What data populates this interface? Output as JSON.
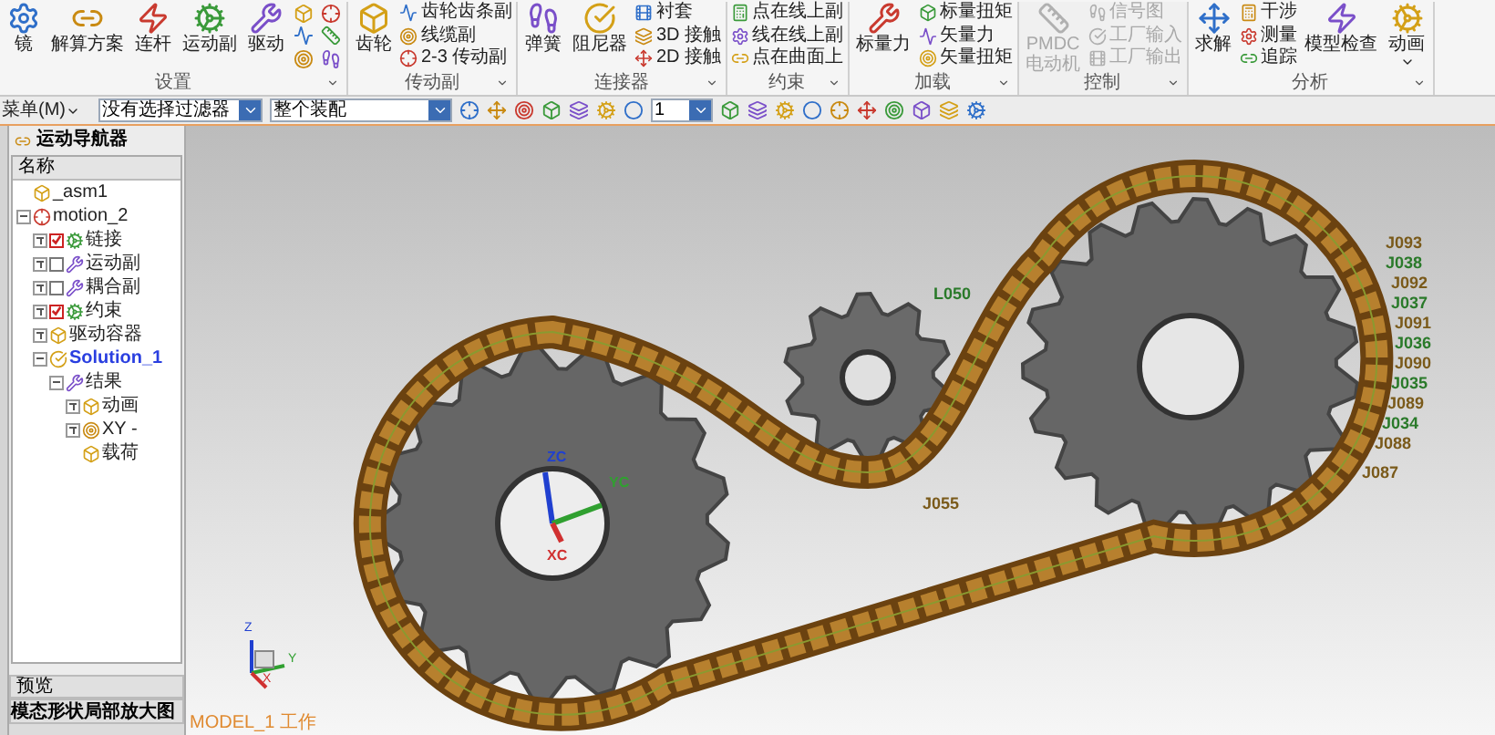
{
  "ribbon": {
    "groups": [
      {
        "label": "设置",
        "disabled": false,
        "buttons": [
          {
            "kind": "large",
            "label": "镜"
          },
          {
            "kind": "large",
            "label": "解算方案"
          },
          {
            "kind": "large",
            "label": "连杆"
          },
          {
            "kind": "large",
            "label": "运动副"
          },
          {
            "kind": "large",
            "label": "驱动"
          },
          {
            "kind": "icon"
          },
          {
            "kind": "icon"
          },
          {
            "kind": "icon"
          },
          {
            "kind": "icon"
          },
          {
            "kind": "icon"
          },
          {
            "kind": "icon"
          }
        ]
      },
      {
        "label": "传动副",
        "disabled": false,
        "buttons": [
          {
            "kind": "large",
            "label": "齿轮"
          },
          {
            "kind": "small",
            "label": "齿轮齿条副"
          },
          {
            "kind": "small",
            "label": "线缆副"
          },
          {
            "kind": "small",
            "label": "2-3 传动副"
          }
        ]
      },
      {
        "label": "连接器",
        "disabled": false,
        "buttons": [
          {
            "kind": "large",
            "label": "弹簧"
          },
          {
            "kind": "large",
            "label": "阻尼器"
          },
          {
            "kind": "small",
            "label": "衬套"
          },
          {
            "kind": "small",
            "label": "3D 接触"
          },
          {
            "kind": "small",
            "label": "2D 接触"
          }
        ]
      },
      {
        "label": "约束",
        "disabled": false,
        "buttons": [
          {
            "kind": "small",
            "label": "点在线上副"
          },
          {
            "kind": "small",
            "label": "线在线上副"
          },
          {
            "kind": "small",
            "label": "点在曲面上"
          }
        ]
      },
      {
        "label": "加载",
        "disabled": false,
        "buttons": [
          {
            "kind": "large",
            "label": "标量力"
          },
          {
            "kind": "small",
            "label": "标量扭矩"
          },
          {
            "kind": "small",
            "label": "矢量力"
          },
          {
            "kind": "small",
            "label": "矢量扭矩"
          }
        ]
      },
      {
        "label": "控制",
        "disabled": true,
        "buttons": [
          {
            "kind": "large",
            "label": "PMDC\n电动机"
          },
          {
            "kind": "small",
            "label": "信号图"
          },
          {
            "kind": "small",
            "label": "工厂输入"
          },
          {
            "kind": "small",
            "label": "工厂输出"
          }
        ]
      },
      {
        "label": "分析",
        "disabled": false,
        "buttons": [
          {
            "kind": "large",
            "label": "求解"
          },
          {
            "kind": "small",
            "label": "干涉"
          },
          {
            "kind": "small",
            "label": "测量"
          },
          {
            "kind": "small",
            "label": "追踪"
          },
          {
            "kind": "large",
            "label": "模型检查"
          },
          {
            "kind": "split",
            "label": "动画"
          }
        ]
      }
    ]
  },
  "toolbar": {
    "menu": "菜单(M)",
    "selects": [
      {
        "value": "没有选择过滤器"
      },
      {
        "value": "整个装配"
      },
      {
        "value": "1"
      }
    ]
  },
  "navigator": {
    "title": "运动导航器",
    "column": "名称",
    "tree": [
      {
        "label": "_asm1"
      },
      {
        "label": "motion_2",
        "expanded": true,
        "children": [
          {
            "label": "链接",
            "expanded": false,
            "checked": true,
            "active": false
          },
          {
            "label": "运动副",
            "expanded": false,
            "checked": false,
            "active": false
          },
          {
            "label": "耦合副",
            "expanded": false,
            "checked": false,
            "active": false
          },
          {
            "label": "约束",
            "expanded": false,
            "checked": true,
            "active": false
          },
          {
            "label": "驱动容器",
            "expanded": false,
            "active": false
          },
          {
            "label": "Solution_1",
            "expanded": true,
            "active": true,
            "children": [
              {
                "label": "结果",
                "expanded": true,
                "children": [
                  {
                    "label": "动画",
                    "expanded": false
                  },
                  {
                    "label": "XY -",
                    "expanded": false
                  },
                  {
                    "label": "载荷"
                  }
                ]
              }
            ]
          }
        ]
      }
    ],
    "preview": "预览",
    "detail": "模态形状局部放大图"
  },
  "viewport": {
    "labels": [
      {
        "text": "J093",
        "color": "#7a5a1a"
      },
      {
        "text": "J038",
        "color": "#2a7a2a"
      },
      {
        "text": "J092",
        "color": "#7a5a1a"
      },
      {
        "text": "J037",
        "color": "#2a7a2a"
      },
      {
        "text": "J091",
        "color": "#7a5a1a"
      },
      {
        "text": "J036",
        "color": "#2a7a2a"
      },
      {
        "text": "J090",
        "color": "#7a5a1a"
      },
      {
        "text": "J035",
        "color": "#2a7a2a"
      },
      {
        "text": "J089",
        "color": "#7a5a1a"
      },
      {
        "text": "J034",
        "color": "#2a7a2a"
      },
      {
        "text": "J088",
        "color": "#7a5a1a"
      },
      {
        "text": "J087",
        "color": "#7a5a1a"
      },
      {
        "text": "L050",
        "color": "#2a7a2a"
      },
      {
        "text": "J055",
        "color": "#7a5a1a"
      }
    ],
    "axes": [
      "ZC",
      "XC",
      "YC"
    ],
    "triad": [
      "Z",
      "Y",
      "X"
    ],
    "status": "MODEL_1 工作"
  }
}
